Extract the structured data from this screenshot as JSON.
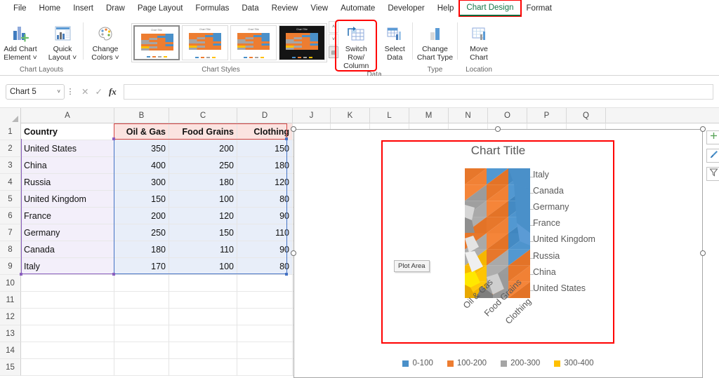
{
  "menubar": {
    "items": [
      {
        "label": "File",
        "active": false
      },
      {
        "label": "Home",
        "active": false
      },
      {
        "label": "Insert",
        "active": false
      },
      {
        "label": "Draw",
        "active": false
      },
      {
        "label": "Page Layout",
        "active": false
      },
      {
        "label": "Formulas",
        "active": false
      },
      {
        "label": "Data",
        "active": false
      },
      {
        "label": "Review",
        "active": false
      },
      {
        "label": "View",
        "active": false
      },
      {
        "label": "Automate",
        "active": false
      },
      {
        "label": "Developer",
        "active": false
      },
      {
        "label": "Help",
        "active": false
      },
      {
        "label": "Chart Design",
        "active": true
      },
      {
        "label": "Format",
        "active": false
      }
    ]
  },
  "ribbon": {
    "groups": [
      {
        "name": "Chart Layouts",
        "label": "Chart Layouts",
        "buttons": [
          {
            "label": "Add Chart\nElement ˅",
            "icon": "add-chart-element-icon",
            "name": "add-chart-element-button"
          },
          {
            "label": "Quick\nLayout ˅",
            "icon": "quick-layout-icon",
            "name": "quick-layout-button"
          }
        ]
      },
      {
        "name": "Chart Colors",
        "label": "",
        "buttons": [
          {
            "label": "Change\nColors ˅",
            "icon": "change-colors-icon",
            "name": "change-colors-button"
          }
        ]
      },
      {
        "name": "Chart Styles",
        "label": "Chart Styles",
        "buttons": []
      },
      {
        "name": "Data",
        "label": "Data",
        "buttons": [
          {
            "label": "Switch Row/\nColumn",
            "icon": "switch-row-column-icon",
            "name": "switch-row-column-button",
            "annotated": true
          },
          {
            "label": "Select\nData",
            "icon": "select-data-icon",
            "name": "select-data-button"
          }
        ]
      },
      {
        "name": "Type",
        "label": "Type",
        "buttons": [
          {
            "label": "Change\nChart Type",
            "icon": "change-chart-type-icon",
            "name": "change-chart-type-button"
          }
        ]
      },
      {
        "name": "Location",
        "label": "Location",
        "buttons": [
          {
            "label": "Move\nChart",
            "icon": "move-chart-icon",
            "name": "move-chart-button"
          }
        ]
      }
    ],
    "gallery": {
      "scroll_up": "˄",
      "scroll_down": "˅",
      "more": "▤",
      "thumbs": [
        {
          "title": "Chart Title",
          "selected": true,
          "dark": false
        },
        {
          "title": "Chart Title",
          "selected": false,
          "dark": false
        },
        {
          "title": "Chart Title",
          "selected": false,
          "dark": false
        },
        {
          "title": "Chart Title",
          "selected": false,
          "dark": true
        }
      ]
    }
  },
  "formula_bar": {
    "name_box_value": "Chart 5",
    "name_box_chevron": "˅",
    "cancel_icon": "✕",
    "confirm_icon": "✓",
    "function_icon": "fx",
    "dots_icon": "⋮",
    "input_value": ""
  },
  "sheet": {
    "column_headers": [
      "A",
      "B",
      "C",
      "D",
      "J",
      "K",
      "L",
      "M",
      "N",
      "O",
      "P",
      "Q"
    ],
    "row_headers": [
      "1",
      "2",
      "3",
      "4",
      "5",
      "6",
      "7",
      "8",
      "9",
      "10",
      "11",
      "12",
      "13",
      "14",
      "15"
    ],
    "table": {
      "header": [
        "Country",
        "Oil & Gas",
        "Food Grains",
        "Clothing"
      ],
      "rows": [
        [
          "United States",
          "350",
          "200",
          "150"
        ],
        [
          "China",
          "400",
          "250",
          "180"
        ],
        [
          "Russia",
          "300",
          "180",
          "120"
        ],
        [
          "United Kingdom",
          "150",
          "100",
          "80"
        ],
        [
          "France",
          "200",
          "120",
          "90"
        ],
        [
          "Germany",
          "250",
          "150",
          "110"
        ],
        [
          "Canada",
          "180",
          "110",
          "90"
        ],
        [
          "Italy",
          "170",
          "100",
          "80"
        ]
      ]
    }
  },
  "chart": {
    "title": "Chart Title",
    "plot_area_tooltip": "Plot Area",
    "category_labels": [
      "Italy",
      "Canada",
      "Germany",
      "France",
      "United Kingdom",
      "Russia",
      "China",
      "United States"
    ],
    "axis_labels": [
      "Oil & Gas",
      "Food Grains",
      "Clothing"
    ],
    "legend": [
      {
        "label": "0-100",
        "color": "#4A90C9"
      },
      {
        "label": "100-200",
        "color": "#ED7D31"
      },
      {
        "label": "200-300",
        "color": "#A5A5A5"
      },
      {
        "label": "300-400",
        "color": "#FFC000"
      }
    ],
    "side_buttons": [
      {
        "name": "chart-elements-button",
        "icon": "plus-icon"
      },
      {
        "name": "chart-styles-button",
        "icon": "paintbrush-icon"
      },
      {
        "name": "chart-filters-button",
        "icon": "funnel-icon"
      }
    ]
  },
  "chart_data": {
    "type": "surface",
    "title": "Chart Title",
    "categories": [
      "Oil & Gas",
      "Food Grains",
      "Clothing"
    ],
    "series": [
      {
        "name": "United States",
        "values": [
          350,
          200,
          150
        ]
      },
      {
        "name": "China",
        "values": [
          400,
          250,
          180
        ]
      },
      {
        "name": "Russia",
        "values": [
          300,
          180,
          120
        ]
      },
      {
        "name": "United Kingdom",
        "values": [
          150,
          100,
          80
        ]
      },
      {
        "name": "France",
        "values": [
          200,
          120,
          90
        ]
      },
      {
        "name": "Germany",
        "values": [
          250,
          150,
          110
        ]
      },
      {
        "name": "Canada",
        "values": [
          180,
          110,
          90
        ]
      },
      {
        "name": "Italy",
        "values": [
          170,
          100,
          80
        ]
      }
    ],
    "bands": [
      {
        "label": "0-100",
        "min": 0,
        "max": 100,
        "color": "#4A90C9"
      },
      {
        "label": "100-200",
        "min": 100,
        "max": 200,
        "color": "#ED7D31"
      },
      {
        "label": "200-300",
        "min": 200,
        "max": 300,
        "color": "#A5A5A5"
      },
      {
        "label": "300-400",
        "min": 300,
        "max": 400,
        "color": "#FFC000"
      }
    ],
    "xlabel": "",
    "ylabel": "",
    "zlim": [
      0,
      400
    ],
    "legend_position": "bottom",
    "grid": false
  }
}
